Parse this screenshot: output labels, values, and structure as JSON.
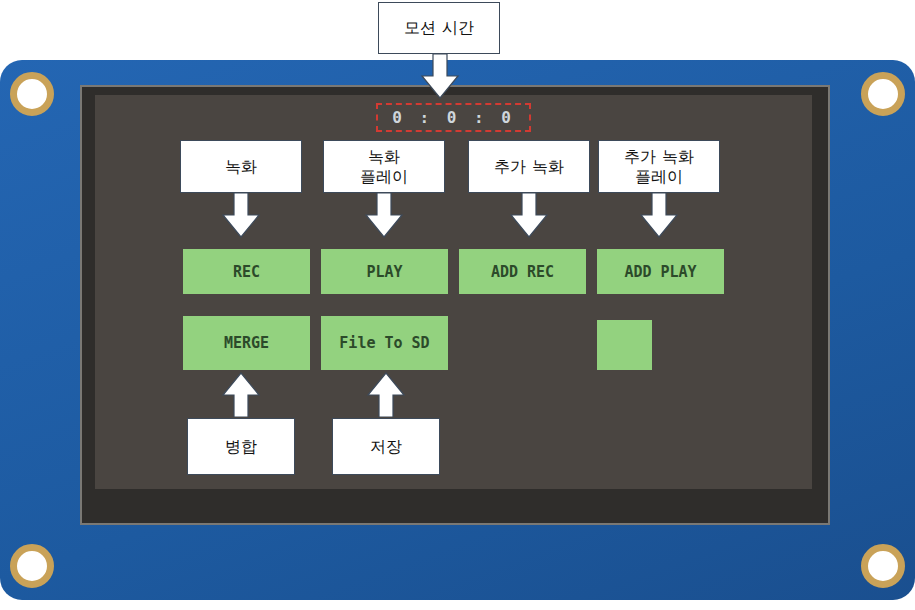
{
  "motion_time": {
    "callout": "모션 시간",
    "value": "0 : 0 : 0"
  },
  "buttons_top_row": [
    {
      "label": "REC",
      "callout": "녹화"
    },
    {
      "label": "PLAY",
      "callout": "녹화\n플레이"
    },
    {
      "label": "ADD REC",
      "callout": "추가 녹화"
    },
    {
      "label": "ADD PLAY",
      "callout": "추가 녹화\n플레이"
    }
  ],
  "buttons_bottom_row": [
    {
      "label": "MERGE",
      "callout": "병합"
    },
    {
      "label": "File To SD",
      "callout": "저장"
    }
  ]
}
